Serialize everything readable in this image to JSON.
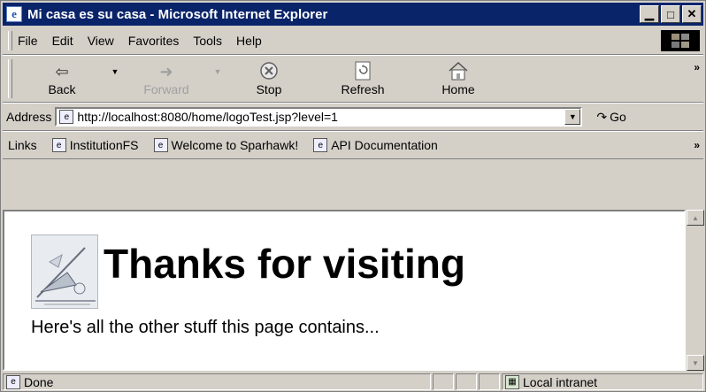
{
  "window": {
    "title": "Mi casa es su casa - Microsoft Internet Explorer"
  },
  "menu": [
    "File",
    "Edit",
    "View",
    "Favorites",
    "Tools",
    "Help"
  ],
  "toolbar": {
    "back": "Back",
    "forward": "Forward",
    "stop": "Stop",
    "refresh": "Refresh",
    "home": "Home"
  },
  "address": {
    "label": "Address",
    "url": "http://localhost:8080/home/logoTest.jsp?level=1",
    "go": "Go"
  },
  "links": {
    "label": "Links",
    "items": [
      "InstitutionFS",
      "Welcome to Sparhawk!",
      "API Documentation"
    ]
  },
  "page": {
    "heading": "Thanks for visiting",
    "body": "Here's all the other stuff this page contains..."
  },
  "status": {
    "text": "Done",
    "zone": "Local intranet"
  },
  "icons": [
    "ie-page-icon",
    "back-arrow-icon",
    "forward-arrow-icon",
    "stop-icon",
    "refresh-icon",
    "home-icon",
    "go-arrow-icon",
    "windows-logo-icon",
    "logo-image"
  ],
  "colors": {
    "titlebar": "#0a246a",
    "chrome": "#d4d0c8",
    "content": "#ffffff"
  }
}
